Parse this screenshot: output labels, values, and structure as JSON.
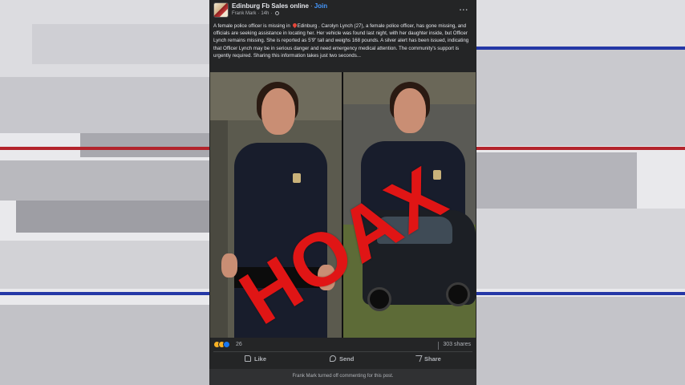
{
  "post": {
    "page_name": "Edinburg Fb Sales online",
    "join_label": "Join",
    "author": "Frank Mark",
    "time": "14h",
    "more_label": "...",
    "text_before_pin": "A female police officer is missing in ",
    "text_after_pin": "Edinburg . Carolyn Lynch (27), a female police officer, has gone missing, and officials are seeking assistance in locating her. Her vehicle was found last night, with her daughter inside, but Officer Lynch remains missing. She is reported as 5'9\" tall and weighs 168 pounds. A silver alert has been issued, indicating that Officer Lynch may be in serious danger and need emergency medical attention. The community's support is urgently required. Sharing this information takes just two seconds...",
    "overlay_stamp": "HOAX",
    "reaction_count": "26",
    "share_count": "303 shares",
    "actions": {
      "like": "Like",
      "send": "Send",
      "share": "Share"
    },
    "comment_notice": "Frank Mark turned off commenting for this post."
  },
  "colors": {
    "card_bg": "#242526",
    "link_blue": "#4599ff",
    "stamp_red": "#e01515",
    "stripe_red": "#b3242c",
    "stripe_blue": "#2437a6"
  },
  "icons": [
    "page-avatar-icon",
    "globe-icon",
    "pin-icon",
    "haha-reaction-icon",
    "sad-reaction-icon",
    "like-reaction-icon",
    "thumb-up-icon",
    "send-icon",
    "share-arrow-icon"
  ]
}
